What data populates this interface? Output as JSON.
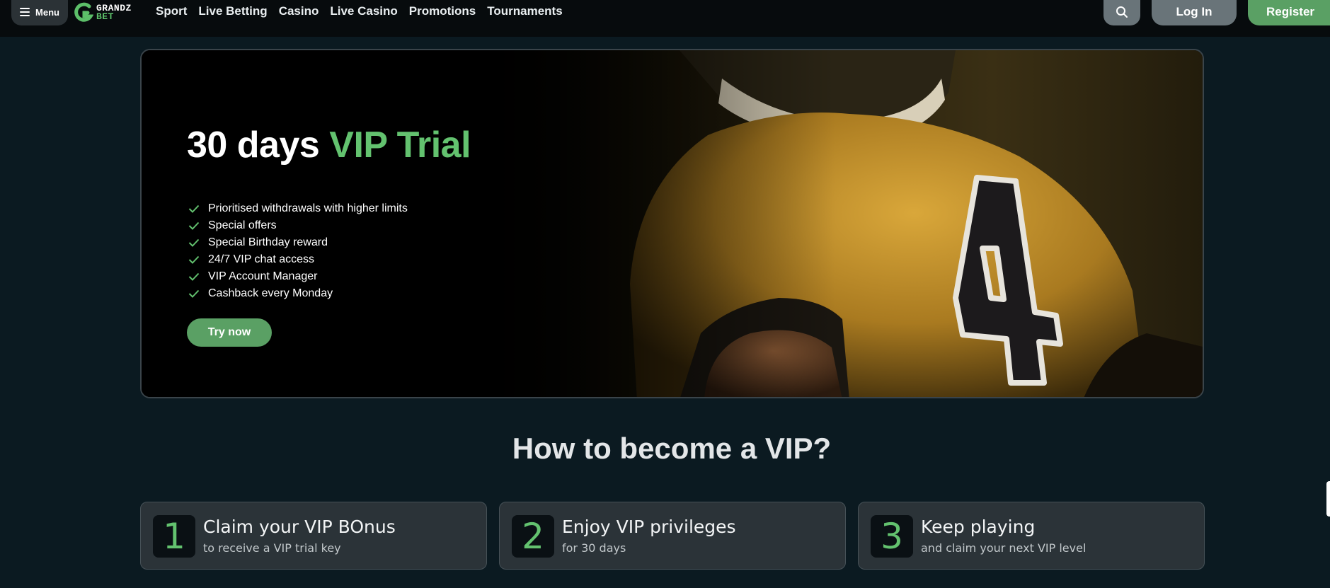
{
  "header": {
    "menu_label": "Menu",
    "logo": {
      "line1": "GRANDZ",
      "line2": "BET"
    },
    "nav": [
      "Sport",
      "Live Betting",
      "Casino",
      "Live Casino",
      "Promotions",
      "Tournaments"
    ],
    "login_label": "Log In",
    "register_label": "Register"
  },
  "hero": {
    "title_white": "30 days",
    "title_accent": "VIP Trial",
    "benefits": [
      "Prioritised withdrawals with higher limits",
      "Special offers",
      "Special Birthday reward",
      "24/7 VIP chat access",
      "VIP Account Manager",
      "Cashback every Monday"
    ],
    "cta_label": "Try now",
    "jersey_number": "4"
  },
  "how": {
    "title": "How to become a VIP?",
    "steps": [
      {
        "num": "1",
        "title": "Claim your VIP BOnus",
        "sub": "to receive a VIP trial key"
      },
      {
        "num": "2",
        "title": "Enjoy VIP privileges",
        "sub": "for 30 days"
      },
      {
        "num": "3",
        "title": "Keep playing",
        "sub": "and claim your next VIP level"
      }
    ]
  },
  "colors": {
    "accent_green": "#63c26f",
    "button_green": "#5aa064",
    "page_bg": "#0b1a21",
    "header_bg": "#070b0d"
  }
}
